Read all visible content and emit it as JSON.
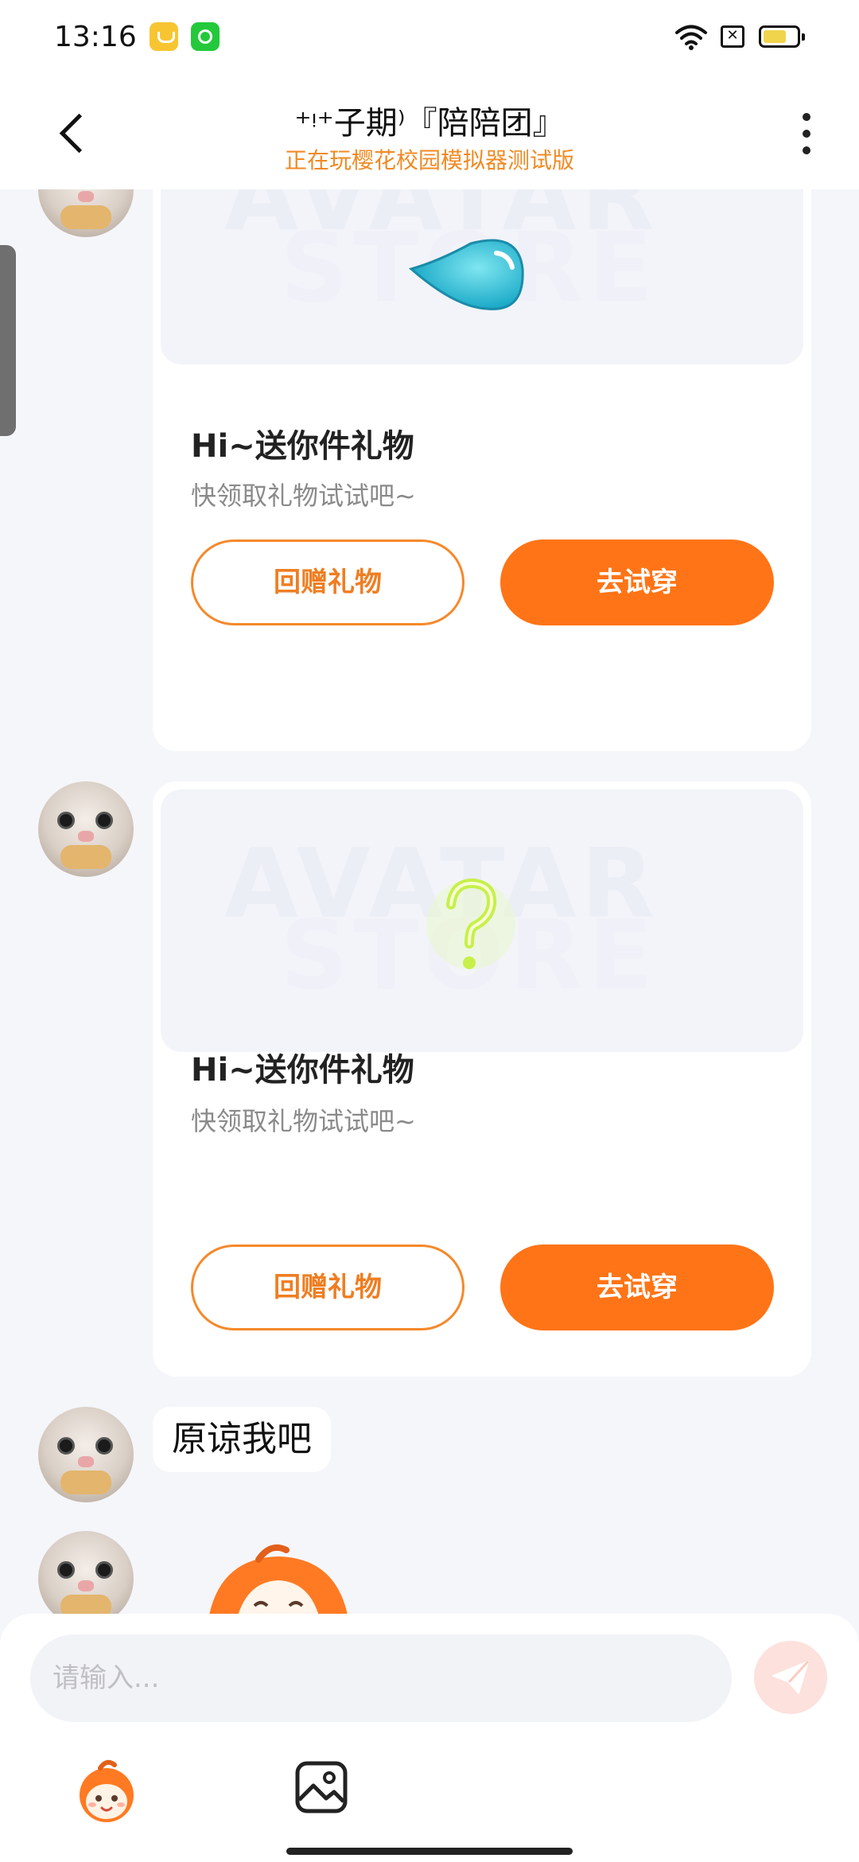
{
  "status_bar": {
    "time": "13:16",
    "sim_glyph": "✕"
  },
  "header": {
    "title": "⁺ᵎ⁺子期⁾『陪陪团』",
    "subtitle": "正在玩樱花校园模拟器测试版"
  },
  "messages": [
    {
      "type": "gift",
      "preview_icon": "water-drop-icon",
      "watermark_line1": "AVATAR",
      "watermark_line2": "STORE",
      "title": "Hi~送你件礼物",
      "desc": "快领取礼物试试吧~",
      "return_label": "回赠礼物",
      "try_label": "去试穿"
    },
    {
      "type": "gift",
      "preview_icon": "question-mark-icon",
      "watermark_line1": "AVATAR",
      "watermark_line2": "STORE",
      "title": "Hi~送你件礼物",
      "desc": "快领取礼物试试吧~",
      "return_label": "回赠礼物",
      "try_label": "去试穿"
    },
    {
      "type": "text",
      "text": "原谅我吧"
    },
    {
      "type": "sticker",
      "icon": "cartoon-character-sticker"
    }
  ],
  "input": {
    "placeholder": "请输入..."
  },
  "toolbar": {
    "emoji_icon": "emoji-character-icon",
    "image_icon": "image-icon"
  },
  "colors": {
    "accent": "#ff7416",
    "subtitle": "#f08a24",
    "background": "#f5f6fa"
  }
}
